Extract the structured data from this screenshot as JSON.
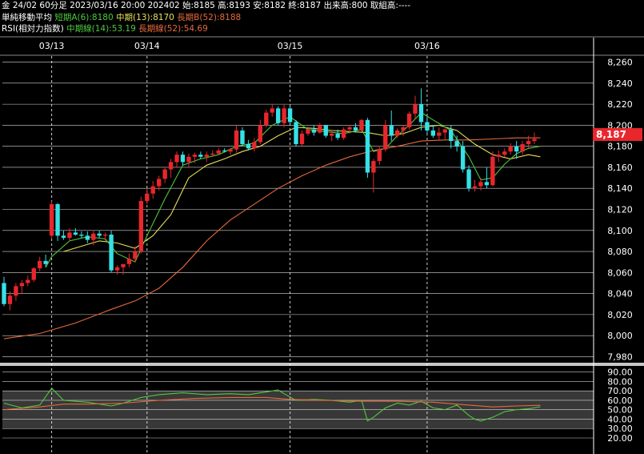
{
  "header": {
    "line1": {
      "symbol": "金 24/02 60分足",
      "datetime": "2023/03/16 20:00",
      "contract": "202402",
      "open": "始:8185",
      "high": "高:8193",
      "low": "安:8182",
      "close": "終:8187",
      "volume": "出来高:800",
      "oi": "取組高:----"
    },
    "line2": {
      "title": "単純移動平均",
      "short": "短期A(6):8180",
      "mid": "中期(13):8170",
      "long": "長期B(52):8188"
    },
    "line3": {
      "title": "RSI(相対力指数)",
      "mid": "中期線(14):53.19",
      "long": "長期線(52):54.69"
    }
  },
  "colors": {
    "up": "#e8262c",
    "down": "#36e1e6",
    "ma_short": "#4ec93d",
    "ma_mid": "#e6e05a",
    "ma_long": "#e66a3a",
    "rsi_mid": "#4ec93d",
    "rsi_long": "#e66a3a",
    "background": "#000000",
    "grid": "#ffffff"
  },
  "last_price_label": "8,187",
  "chart_data": [
    {
      "type": "candlestick",
      "x_tick_labels": [
        {
          "label": "03/13",
          "bar": 8
        },
        {
          "label": "03/14",
          "bar": 24
        },
        {
          "label": "03/15",
          "bar": 48
        },
        {
          "label": "03/16",
          "bar": 71
        }
      ],
      "y_ticks": [
        "7,980",
        "8,000",
        "8,020",
        "8,040",
        "8,060",
        "8,080",
        "8,100",
        "8,120",
        "8,140",
        "8,160",
        "8,180",
        "8,200",
        "8,220",
        "8,240",
        "8,260"
      ],
      "ylim": [
        7975,
        8265
      ],
      "candles": [
        [
          8050,
          8056,
          8028,
          8030
        ],
        [
          8030,
          8042,
          8024,
          8038
        ],
        [
          8038,
          8050,
          8033,
          8047
        ],
        [
          8047,
          8053,
          8040,
          8050
        ],
        [
          8050,
          8057,
          8047,
          8053
        ],
        [
          8053,
          8065,
          8051,
          8064
        ],
        [
          8064,
          8075,
          8061,
          8071
        ],
        [
          8071,
          8077,
          8065,
          8068
        ],
        [
          8095,
          8128,
          8092,
          8125
        ],
        [
          8125,
          8126,
          8090,
          8095
        ],
        [
          8095,
          8100,
          8091,
          8093
        ],
        [
          8093,
          8102,
          8090,
          8098
        ],
        [
          8098,
          8102,
          8095,
          8096
        ],
        [
          8096,
          8099,
          8093,
          8095
        ],
        [
          8095,
          8099,
          8088,
          8091
        ],
        [
          8091,
          8100,
          8086,
          8097
        ],
        [
          8097,
          8100,
          8093,
          8095
        ],
        [
          8095,
          8098,
          8090,
          8096
        ],
        [
          8096,
          8100,
          8060,
          8062
        ],
        [
          8062,
          8067,
          8058,
          8065
        ],
        [
          8065,
          8068,
          8058,
          8068
        ],
        [
          8068,
          8078,
          8065,
          8073
        ],
        [
          8073,
          8085,
          8070,
          8080
        ],
        [
          8080,
          8132,
          8078,
          8128
        ],
        [
          8128,
          8140,
          8125,
          8135
        ],
        [
          8135,
          8147,
          8130,
          8142
        ],
        [
          8142,
          8152,
          8138,
          8149
        ],
        [
          8149,
          8160,
          8145,
          8158
        ],
        [
          8158,
          8168,
          8150,
          8165
        ],
        [
          8165,
          8175,
          8160,
          8172
        ],
        [
          8172,
          8175,
          8162,
          8165
        ],
        [
          8165,
          8173,
          8160,
          8170
        ],
        [
          8170,
          8174,
          8164,
          8172
        ],
        [
          8172,
          8175,
          8168,
          8170
        ],
        [
          8170,
          8175,
          8165,
          8172
        ],
        [
          8172,
          8176,
          8170,
          8173
        ],
        [
          8173,
          8178,
          8172,
          8176
        ],
        [
          8176,
          8178,
          8174,
          8175
        ],
        [
          8175,
          8178,
          8172,
          8177
        ],
        [
          8177,
          8200,
          8174,
          8195
        ],
        [
          8195,
          8198,
          8180,
          8182
        ],
        [
          8182,
          8186,
          8176,
          8178
        ],
        [
          8178,
          8188,
          8175,
          8184
        ],
        [
          8184,
          8205,
          8182,
          8200
        ],
        [
          8200,
          8215,
          8198,
          8212
        ],
        [
          8212,
          8220,
          8208,
          8216
        ],
        [
          8216,
          8218,
          8200,
          8202
        ],
        [
          8202,
          8220,
          8198,
          8216
        ],
        [
          8216,
          8218,
          8200,
          8203
        ],
        [
          8203,
          8205,
          8180,
          8182
        ],
        [
          8182,
          8195,
          8180,
          8192
        ],
        [
          8192,
          8197,
          8190,
          8196
        ],
        [
          8196,
          8200,
          8190,
          8193
        ],
        [
          8193,
          8202,
          8192,
          8200
        ],
        [
          8200,
          8200,
          8188,
          8190
        ],
        [
          8190,
          8195,
          8185,
          8192
        ],
        [
          8192,
          8196,
          8186,
          8188
        ],
        [
          8188,
          8198,
          8186,
          8196
        ],
        [
          8196,
          8200,
          8192,
          8198
        ],
        [
          8198,
          8202,
          8193,
          8195
        ],
        [
          8195,
          8206,
          8194,
          8205
        ],
        [
          8205,
          8207,
          8150,
          8155
        ],
        [
          8155,
          8168,
          8136,
          8166
        ],
        [
          8166,
          8180,
          8162,
          8177
        ],
        [
          8177,
          8205,
          8175,
          8200
        ],
        [
          8200,
          8214,
          8185,
          8190
        ],
        [
          8190,
          8197,
          8188,
          8195
        ],
        [
          8195,
          8200,
          8190,
          8198
        ],
        [
          8198,
          8213,
          8196,
          8211
        ],
        [
          8211,
          8228,
          8206,
          8220
        ],
        [
          8220,
          8235,
          8195,
          8203
        ],
        [
          8203,
          8208,
          8190,
          8195
        ],
        [
          8195,
          8200,
          8188,
          8190
        ],
        [
          8190,
          8198,
          8185,
          8193
        ],
        [
          8193,
          8197,
          8186,
          8196
        ],
        [
          8196,
          8200,
          8178,
          8185
        ],
        [
          8185,
          8190,
          8175,
          8180
        ],
        [
          8180,
          8185,
          8155,
          8158
        ],
        [
          8158,
          8162,
          8137,
          8140
        ],
        [
          8140,
          8148,
          8137,
          8142
        ],
        [
          8142,
          8150,
          8138,
          8146
        ],
        [
          8146,
          8160,
          8140,
          8143
        ],
        [
          8143,
          8175,
          8142,
          8170
        ],
        [
          8170,
          8176,
          8165,
          8172
        ],
        [
          8172,
          8178,
          8170,
          8175
        ],
        [
          8175,
          8183,
          8172,
          8180
        ],
        [
          8180,
          8185,
          8168,
          8175
        ],
        [
          8175,
          8185,
          8172,
          8182
        ],
        [
          8182,
          8190,
          8178,
          8185
        ],
        [
          8185,
          8193,
          8182,
          8187
        ]
      ],
      "ma_short_points": [
        [
          7,
          8065
        ],
        [
          8,
          8075
        ],
        [
          11,
          8090
        ],
        [
          14,
          8094
        ],
        [
          17,
          8092
        ],
        [
          19,
          8078
        ],
        [
          22,
          8070
        ],
        [
          24,
          8095
        ],
        [
          27,
          8130
        ],
        [
          30,
          8162
        ],
        [
          33,
          8168
        ],
        [
          36,
          8172
        ],
        [
          39,
          8180
        ],
        [
          42,
          8183
        ],
        [
          45,
          8200
        ],
        [
          48,
          8208
        ],
        [
          51,
          8196
        ],
        [
          54,
          8194
        ],
        [
          57,
          8192
        ],
        [
          60,
          8196
        ],
        [
          62,
          8175
        ],
        [
          64,
          8178
        ],
        [
          66,
          8190
        ],
        [
          68,
          8200
        ],
        [
          70,
          8212
        ],
        [
          72,
          8205
        ],
        [
          75,
          8195
        ],
        [
          78,
          8170
        ],
        [
          80,
          8148
        ],
        [
          82,
          8150
        ],
        [
          84,
          8163
        ],
        [
          86,
          8173
        ],
        [
          88,
          8178
        ],
        [
          90,
          8180
        ]
      ],
      "ma_mid_points": [
        [
          10,
          8080
        ],
        [
          13,
          8085
        ],
        [
          16,
          8090
        ],
        [
          19,
          8088
        ],
        [
          22,
          8083
        ],
        [
          25,
          8095
        ],
        [
          28,
          8115
        ],
        [
          31,
          8150
        ],
        [
          34,
          8162
        ],
        [
          37,
          8168
        ],
        [
          40,
          8175
        ],
        [
          43,
          8180
        ],
        [
          46,
          8190
        ],
        [
          49,
          8198
        ],
        [
          52,
          8197
        ],
        [
          55,
          8195
        ],
        [
          58,
          8194
        ],
        [
          61,
          8193
        ],
        [
          64,
          8190
        ],
        [
          67,
          8192
        ],
        [
          70,
          8198
        ],
        [
          73,
          8200
        ],
        [
          76,
          8195
        ],
        [
          79,
          8182
        ],
        [
          82,
          8172
        ],
        [
          85,
          8168
        ],
        [
          88,
          8172
        ],
        [
          90,
          8170
        ]
      ],
      "ma_long_points": [
        [
          0,
          7997
        ],
        [
          6,
          8002
        ],
        [
          12,
          8012
        ],
        [
          18,
          8025
        ],
        [
          22,
          8033
        ],
        [
          26,
          8045
        ],
        [
          30,
          8065
        ],
        [
          34,
          8090
        ],
        [
          38,
          8110
        ],
        [
          42,
          8125
        ],
        [
          46,
          8140
        ],
        [
          50,
          8152
        ],
        [
          54,
          8162
        ],
        [
          58,
          8170
        ],
        [
          62,
          8176
        ],
        [
          66,
          8180
        ],
        [
          70,
          8185
        ],
        [
          74,
          8186
        ],
        [
          78,
          8186
        ],
        [
          82,
          8187
        ],
        [
          86,
          8188
        ],
        [
          90,
          8188
        ]
      ]
    },
    {
      "type": "line",
      "name": "RSI",
      "y_ticks": [
        "20.00",
        "30.00",
        "40.00",
        "50.00",
        "60.00",
        "70.00",
        "80.00",
        "90.00"
      ],
      "ylim": [
        20,
        94
      ],
      "series": [
        {
          "name": "中期線(14)",
          "points": [
            [
              0,
              57
            ],
            [
              3,
              52
            ],
            [
              6,
              55
            ],
            [
              8,
              73
            ],
            [
              10,
              60
            ],
            [
              14,
              58
            ],
            [
              18,
              54
            ],
            [
              20,
              57
            ],
            [
              23,
              63
            ],
            [
              26,
              66
            ],
            [
              30,
              68
            ],
            [
              34,
              66
            ],
            [
              38,
              67
            ],
            [
              41,
              66
            ],
            [
              44,
              69
            ],
            [
              46,
              71
            ],
            [
              47,
              67
            ],
            [
              49,
              60
            ],
            [
              52,
              61
            ],
            [
              55,
              60
            ],
            [
              58,
              58
            ],
            [
              60,
              60
            ],
            [
              61,
              38
            ],
            [
              62,
              42
            ],
            [
              64,
              52
            ],
            [
              66,
              57
            ],
            [
              68,
              55
            ],
            [
              70,
              59
            ],
            [
              72,
              52
            ],
            [
              74,
              50
            ],
            [
              76,
              55
            ],
            [
              78,
              44
            ],
            [
              79,
              40
            ],
            [
              80,
              38
            ],
            [
              82,
              42
            ],
            [
              84,
              48
            ],
            [
              86,
              50
            ],
            [
              88,
              51
            ],
            [
              90,
              53.19
            ]
          ]
        },
        {
          "name": "長期線(52)",
          "points": [
            [
              0,
              50
            ],
            [
              6,
              53
            ],
            [
              10,
              56
            ],
            [
              14,
              56
            ],
            [
              20,
              57
            ],
            [
              26,
              60
            ],
            [
              32,
              62
            ],
            [
              38,
              63
            ],
            [
              44,
              63
            ],
            [
              48,
              61
            ],
            [
              54,
              60
            ],
            [
              60,
              59
            ],
            [
              66,
              59
            ],
            [
              72,
              58
            ],
            [
              78,
              55
            ],
            [
              82,
              53
            ],
            [
              86,
              54
            ],
            [
              90,
              54.69
            ]
          ]
        }
      ]
    }
  ]
}
